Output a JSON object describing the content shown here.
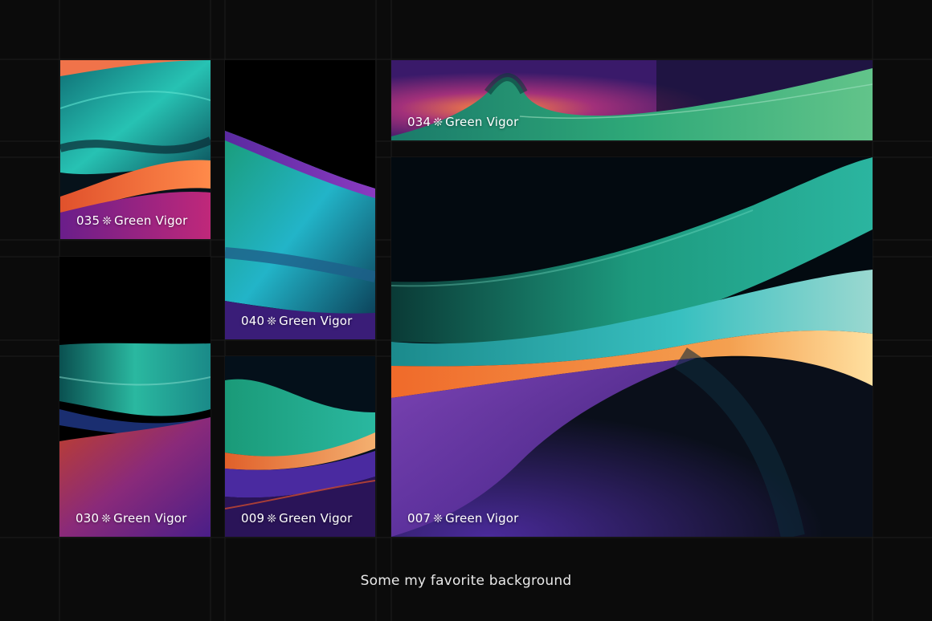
{
  "gallery": {
    "separator_glyph": "❊",
    "tiles": [
      {
        "id": "035",
        "name": "Green Vigor"
      },
      {
        "id": "040",
        "name": "Green Vigor"
      },
      {
        "id": "034",
        "name": "Green Vigor"
      },
      {
        "id": "007",
        "name": "Green Vigor"
      },
      {
        "id": "030",
        "name": "Green Vigor"
      },
      {
        "id": "009",
        "name": "Green Vigor"
      }
    ]
  },
  "footer": {
    "text": "Some my favorite background"
  },
  "colors": {
    "background": "#0b0b0b",
    "teal": "#1fb8a6",
    "green": "#2e9a6a",
    "orange": "#f26a2e",
    "purple": "#5a2a98",
    "magenta": "#b02a8e"
  }
}
